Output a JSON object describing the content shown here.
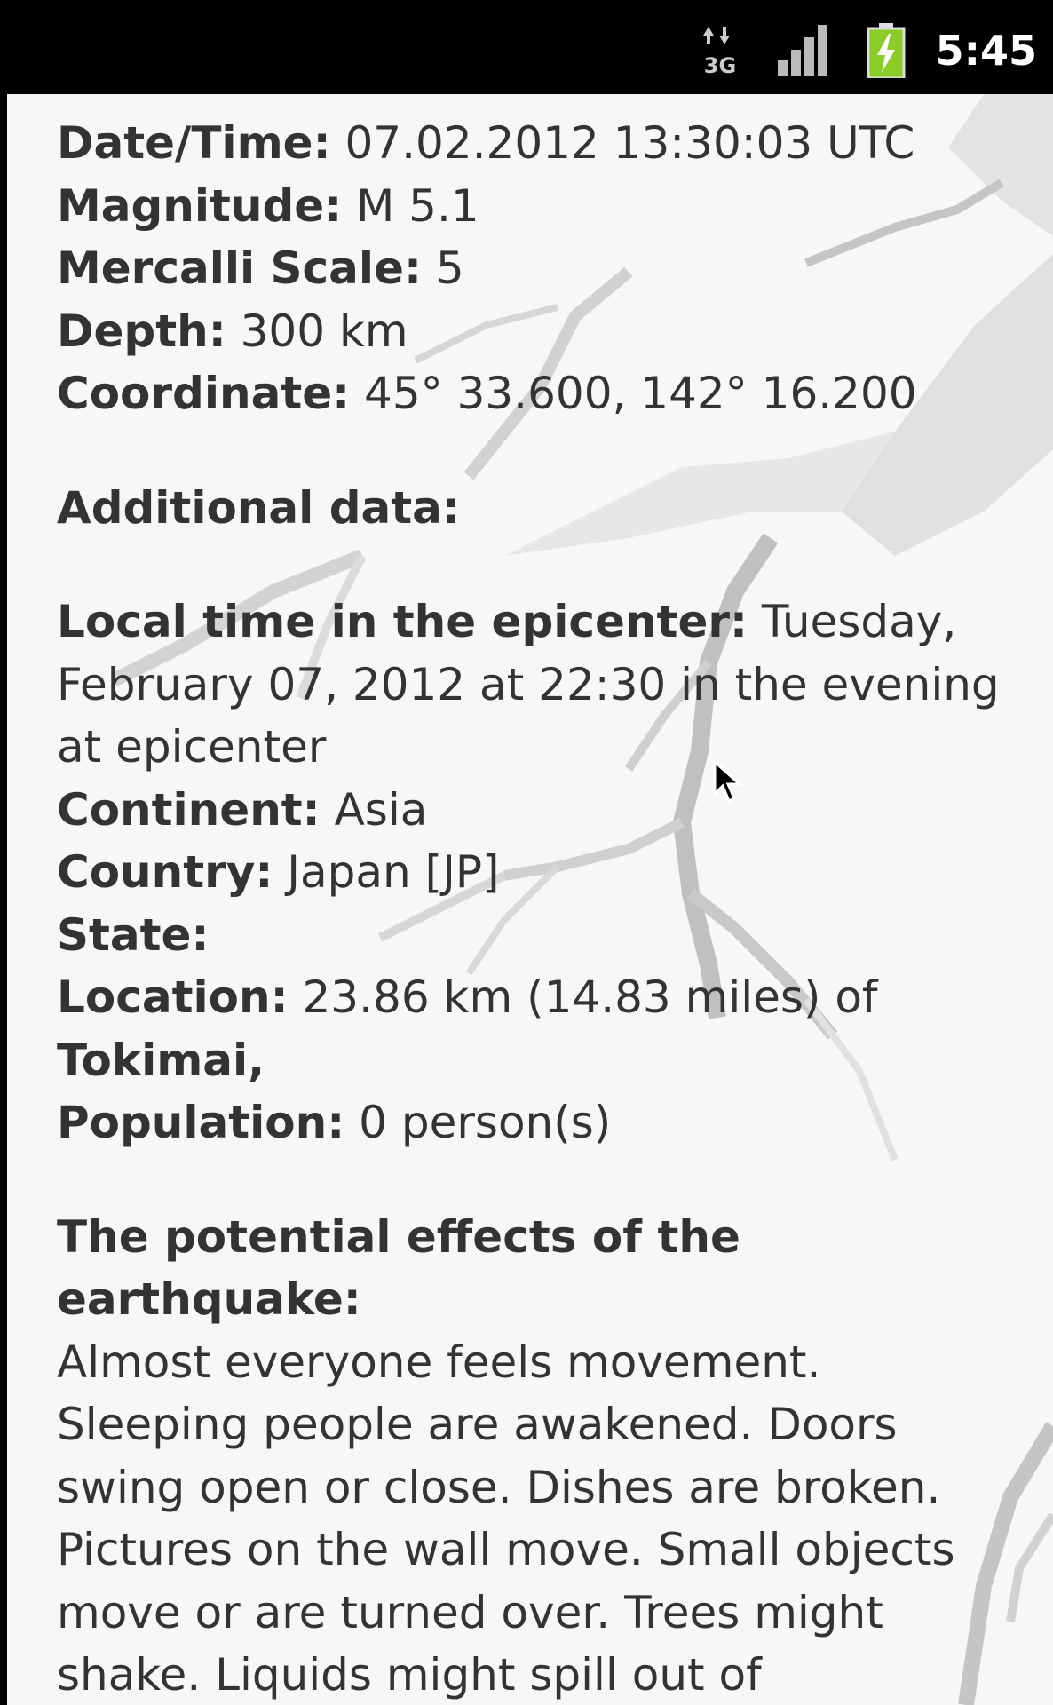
{
  "status_bar": {
    "network_icon": "3g-data-icon",
    "signal_icon": "signal-strength-icon",
    "battery_icon": "battery-charging-icon",
    "battery_color": "#8ccc28",
    "time": "5:45"
  },
  "details": {
    "datetime": {
      "label": "Date/Time:",
      "value": "07.02.2012 13:30:03 UTC"
    },
    "magnitude": {
      "label": "Magnitude:",
      "value": "M 5.1"
    },
    "mercalli": {
      "label": "Mercalli Scale:",
      "value": "5"
    },
    "depth": {
      "label": "Depth:",
      "value": "300 km"
    },
    "coordinate": {
      "label": "Coordinate:",
      "value": "45° 33.600, 142° 16.200"
    }
  },
  "additional": {
    "heading": "Additional data:",
    "local_time": {
      "label": "Local time in the epicenter:",
      "value": "Tuesday, February 07, 2012 at 22:30 in the evening at epicenter"
    },
    "continent": {
      "label": "Continent:",
      "value": "Asia"
    },
    "country": {
      "label": "Country:",
      "value": "Japan [JP]"
    },
    "state": {
      "label": "State:",
      "value": ""
    },
    "location": {
      "label": "Location:",
      "value": "23.86 km (14.83 miles) of",
      "place": "Tokimai,"
    },
    "population": {
      "label": "Population:",
      "value": "0 person(s)"
    }
  },
  "effects": {
    "heading": "The potential effects of the earthquake:",
    "text": "Almost everyone feels movement. Sleeping people are awakened. Doors swing open or close. Dishes are broken. Pictures on the wall move. Small objects move or are turned over. Trees might shake. Liquids might spill out of"
  },
  "colors": {
    "background": "#f6f8f6",
    "text": "#333333",
    "status_bar": "#000000"
  }
}
